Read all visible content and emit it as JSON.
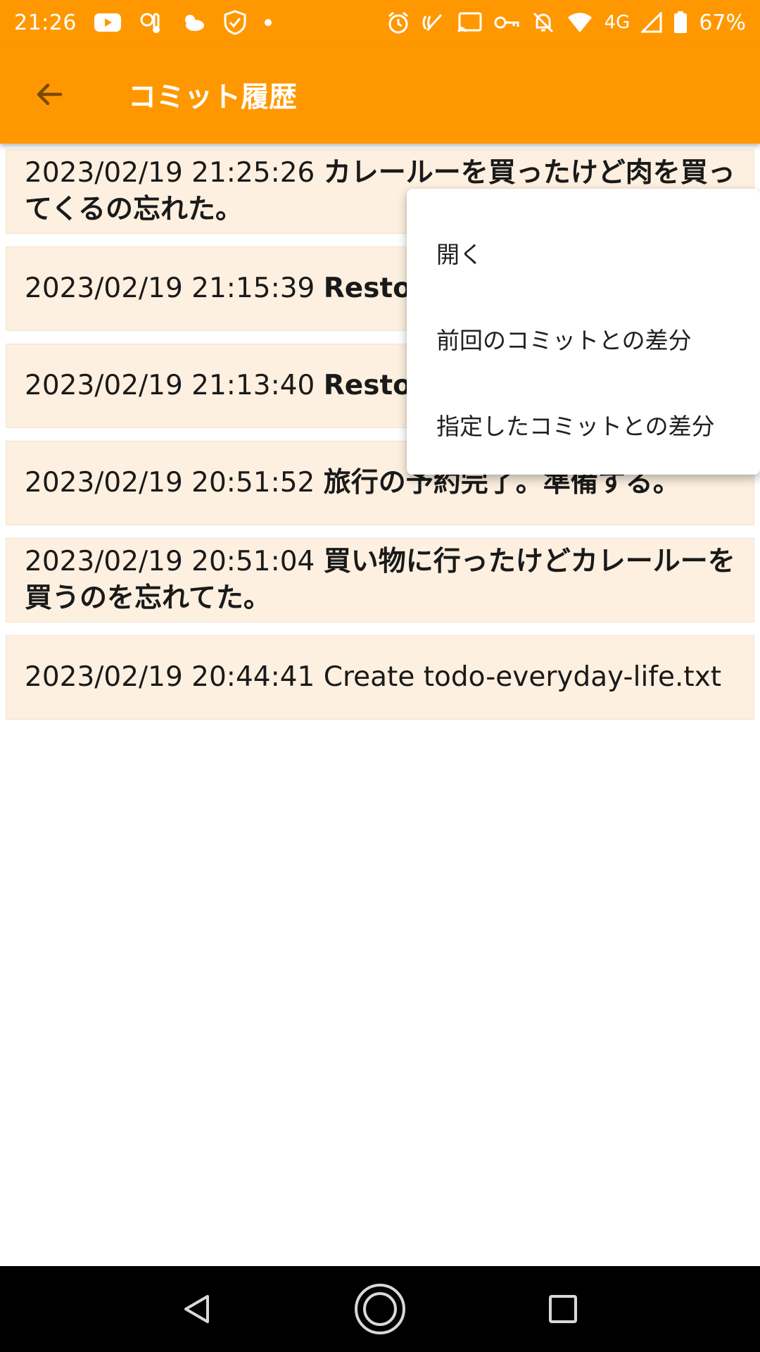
{
  "status_bar": {
    "time": "21:26",
    "network": "4G",
    "battery": "67%",
    "left_icons": [
      "youtube-icon",
      "weather-thermometer-icon",
      "cloudy-icon",
      "shield-check-icon",
      "dot-icon"
    ],
    "right_icons": [
      "alarm-icon",
      "nfc-icon",
      "cast-icon",
      "key-icon",
      "bell-off-icon",
      "wifi-icon",
      "signal-icon",
      "battery-icon"
    ]
  },
  "app_bar": {
    "title": "コミット履歴",
    "background": "#FF9800"
  },
  "commits": [
    {
      "timestamp": "2023/02/19 21:25:26",
      "message": "カレールーを買ったけど肉を買ってくるの忘れた。"
    },
    {
      "timestamp": "2023/02/19 21:15:39",
      "message": "Restore することリスト"
    },
    {
      "timestamp": "2023/02/19 21:13:40",
      "message": "Restore することリスト"
    },
    {
      "timestamp": "2023/02/19 20:51:52",
      "message": "旅行の予約完了。準備する。"
    },
    {
      "timestamp": "2023/02/19 20:51:04",
      "message": "買い物に行ったけどカレールーを買うのを忘れてた。"
    },
    {
      "timestamp": "2023/02/19 20:44:41",
      "message": "Create todo-everyday-life.txt"
    }
  ],
  "context_menu": {
    "items": [
      "開く",
      "前回のコミットとの差分",
      "指定したコミットとの差分"
    ]
  },
  "nav_bar": {
    "icons": [
      "back-triangle-icon",
      "home-circle-icon",
      "recents-square-icon"
    ]
  }
}
